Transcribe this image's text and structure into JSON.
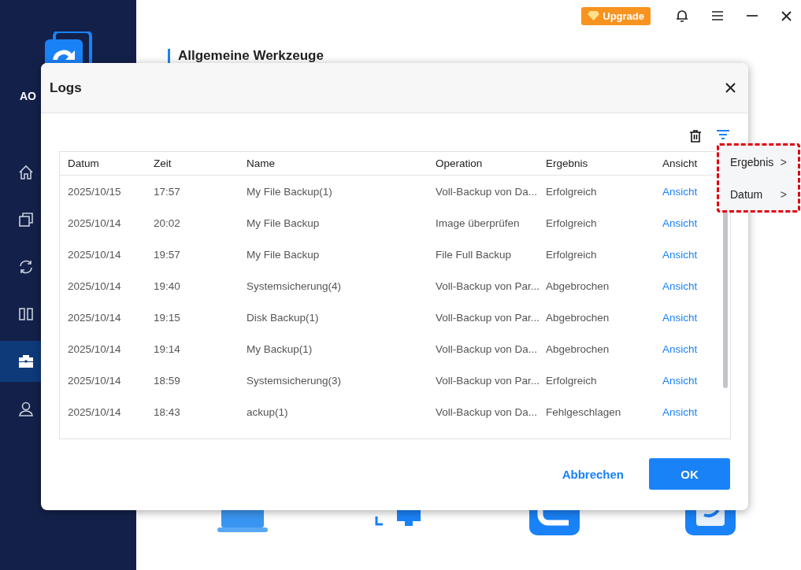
{
  "sidebar": {
    "brand": "AO",
    "items": [
      {
        "kind": "home",
        "selected": false
      },
      {
        "kind": "backup",
        "selected": false
      },
      {
        "kind": "sync",
        "selected": false
      },
      {
        "kind": "clone",
        "selected": false
      },
      {
        "kind": "tools",
        "selected": true
      },
      {
        "kind": "account",
        "selected": false
      }
    ]
  },
  "top_bar": {
    "upgrade": "Upgrade"
  },
  "page": {
    "heading": "Allgemeine Werkzeuge",
    "tiles": [
      {
        "kind": "laptop"
      },
      {
        "kind": "monitor"
      },
      {
        "kind": "app"
      },
      {
        "kind": "app2"
      }
    ]
  },
  "dialog": {
    "title": "Logs",
    "columns": [
      "Datum",
      "Zeit",
      "Name",
      "Operation",
      "Ergebnis",
      "Ansicht"
    ],
    "rows": [
      {
        "date": "2025/10/15",
        "time": "17:57",
        "name": "My File Backup(1)",
        "operation": "Voll-Backup von Da...",
        "result": "Erfolgreich",
        "view": "Ansicht"
      },
      {
        "date": "2025/10/14",
        "time": "20:02",
        "name": "My File Backup",
        "operation": "Image überprüfen",
        "result": "Erfolgreich",
        "view": "Ansicht"
      },
      {
        "date": "2025/10/14",
        "time": "19:57",
        "name": "My File Backup",
        "operation": "File Full Backup",
        "result": "Erfolgreich",
        "view": "Ansicht"
      },
      {
        "date": "2025/10/14",
        "time": "19:40",
        "name": "Systemsicherung(4)",
        "operation": "Voll-Backup von Par...",
        "result": "Abgebrochen",
        "view": "Ansicht"
      },
      {
        "date": "2025/10/14",
        "time": "19:15",
        "name": "Disk Backup(1)",
        "operation": "Voll-Backup von Par...",
        "result": "Abgebrochen",
        "view": "Ansicht"
      },
      {
        "date": "2025/10/14",
        "time": "19:14",
        "name": "My Backup(1)",
        "operation": "Voll-Backup von Da...",
        "result": "Abgebrochen",
        "view": "Ansicht"
      },
      {
        "date": "2025/10/14",
        "time": "18:59",
        "name": "Systemsicherung(3)",
        "operation": "Voll-Backup von Par...",
        "result": "Erfolgreich",
        "view": "Ansicht"
      },
      {
        "date": "2025/10/14",
        "time": "18:43",
        "name": "ackup(1)",
        "operation": "Voll-Backup von Da...",
        "result": "Fehlgeschlagen",
        "view": "Ansicht"
      }
    ],
    "filter_menu": [
      {
        "label": "Ergebnis",
        "arrow": ">"
      },
      {
        "label": "Datum",
        "arrow": ">"
      }
    ],
    "buttons": {
      "cancel": "Abbrechen",
      "ok": "OK"
    }
  }
}
